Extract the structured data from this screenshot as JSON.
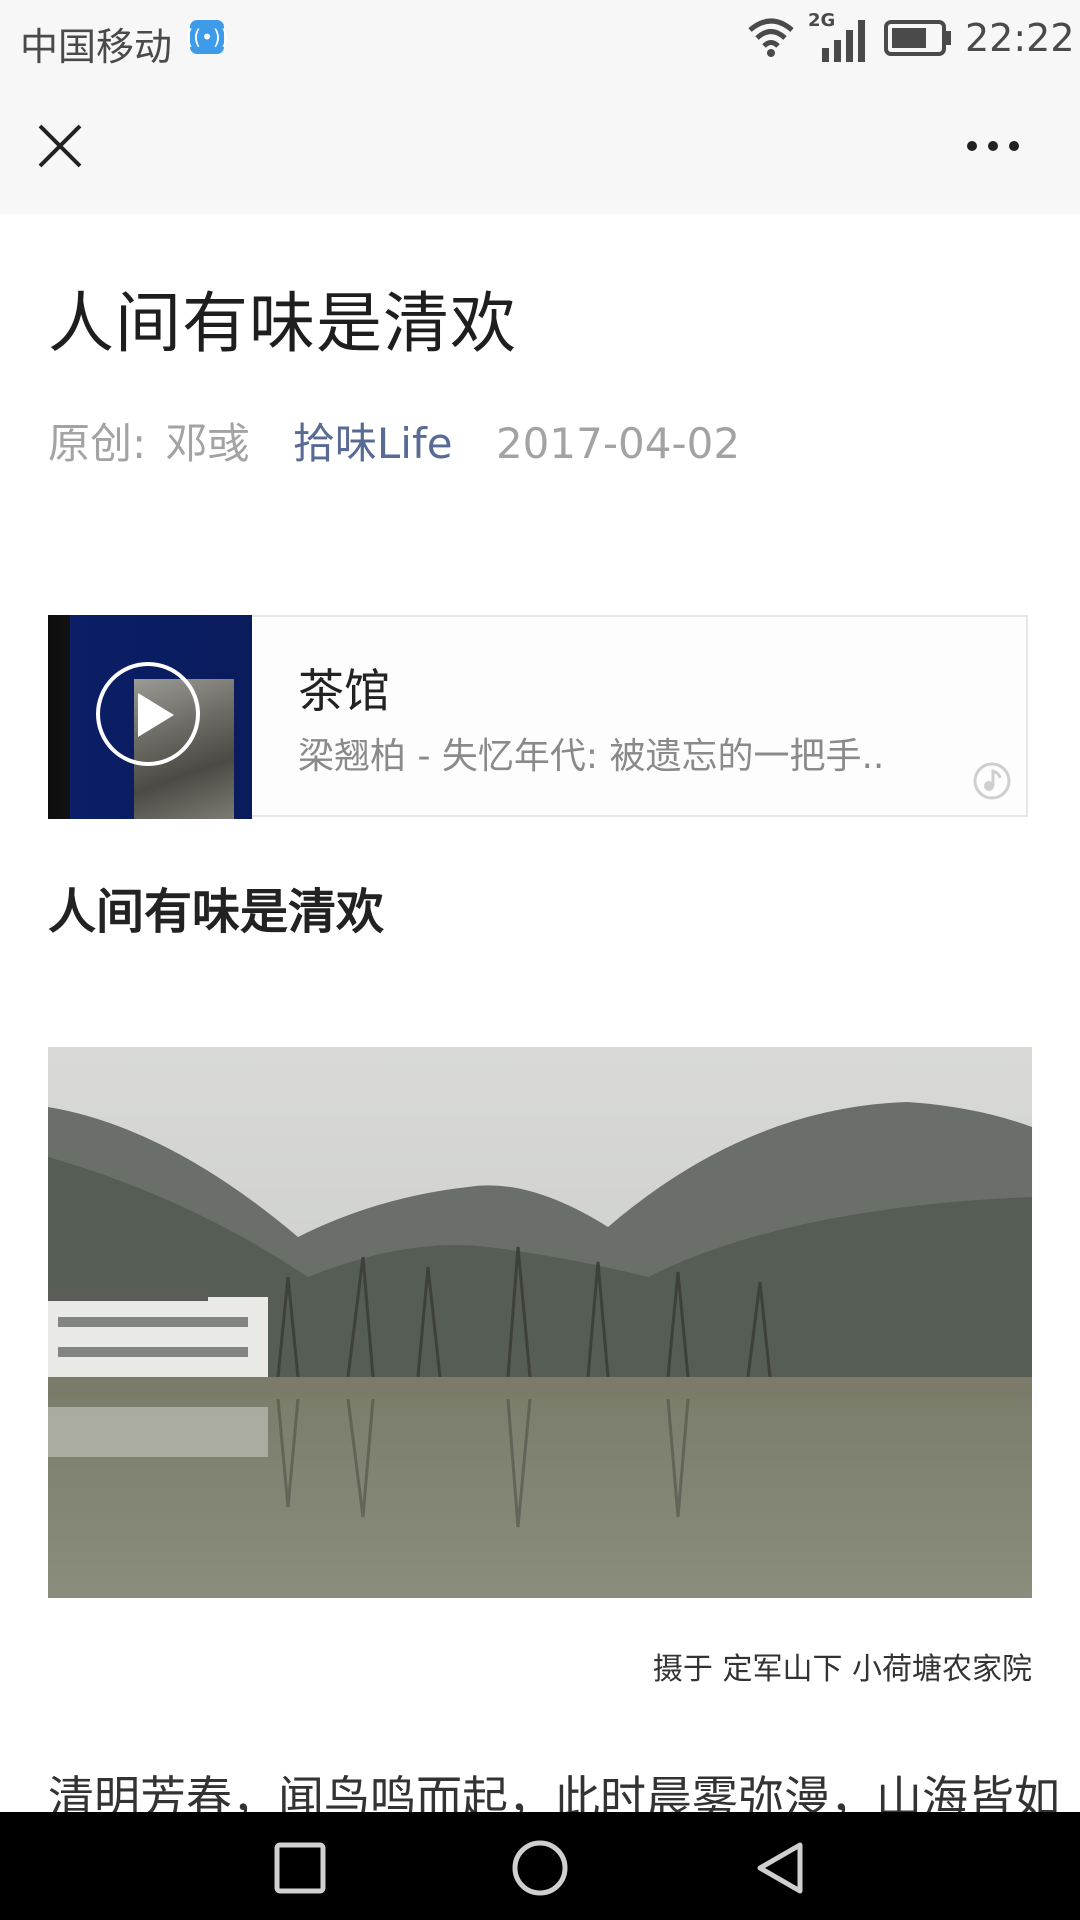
{
  "status_bar": {
    "carrier": "中国移动",
    "network_type": "2G",
    "time": "22:22",
    "icons": [
      "hotspot-icon",
      "wifi-icon",
      "signal-icon",
      "battery-icon"
    ]
  },
  "nav_bar": {
    "close_icon": "close-icon",
    "more_icon": "more-icon"
  },
  "article": {
    "title": "人间有味是清欢",
    "meta": {
      "original_label": "原创:",
      "author": "邓彧",
      "account": "拾味Life",
      "date": "2017-04-02"
    },
    "music": {
      "title": "茶馆",
      "artist_album": "梁翘柏 - 失忆年代: 被遗忘的一把手..",
      "icons": [
        "play-icon",
        "qq-music-icon"
      ]
    },
    "section_heading": "人间有味是清欢",
    "photo_caption": "摄于 定军山下 小荷塘农家院",
    "paragraph_start": "清明芳春，闻鸟鸣而起，此时晨雾弥漫，山海皆如"
  },
  "system_nav": {
    "icons": [
      "recent-apps-icon",
      "home-icon",
      "back-icon"
    ]
  },
  "colors": {
    "link": "#576b95",
    "meta_gray": "#a3a3a3",
    "bar_background": "#f7f7f7"
  }
}
